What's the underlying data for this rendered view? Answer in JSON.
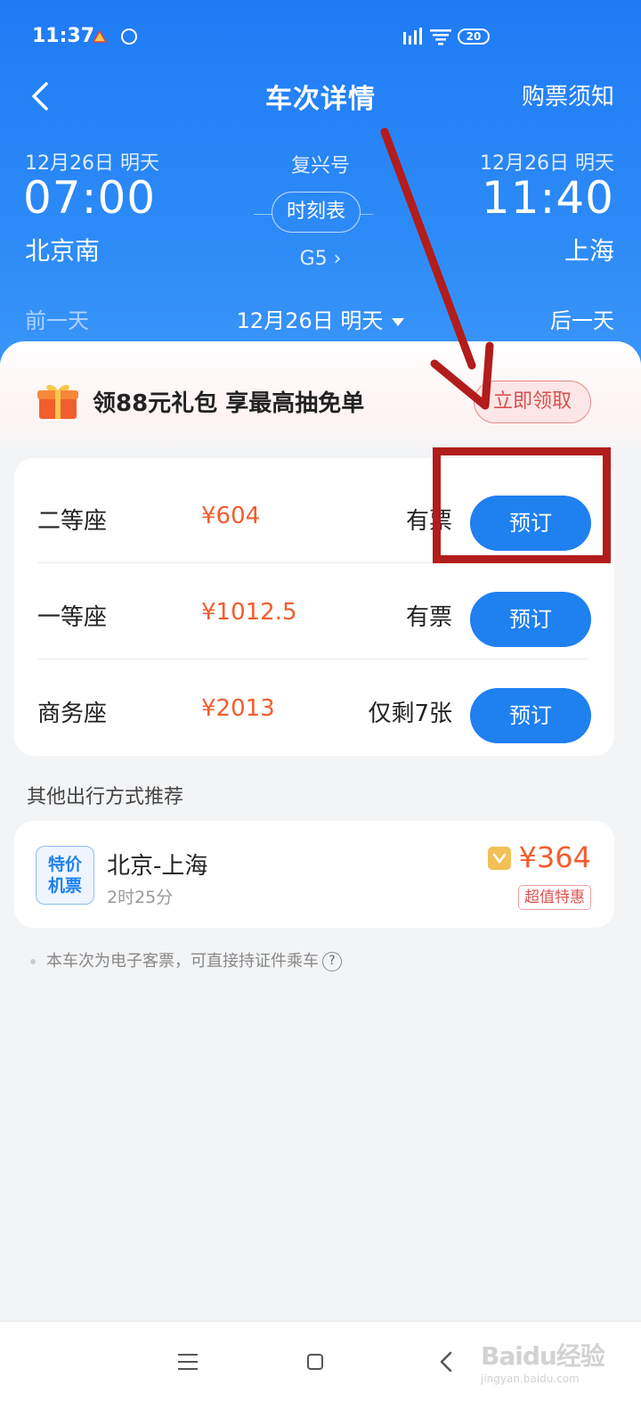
{
  "status_bar": {
    "time": "11:37",
    "battery": "20"
  },
  "nav": {
    "title": "车次详情",
    "notice_link": "购票须知"
  },
  "trip": {
    "departure": {
      "date": "12月26日 明天",
      "time": "07:00",
      "station": "北京南"
    },
    "arrival": {
      "date": "12月26日 明天",
      "time": "11:40",
      "station": "上海"
    },
    "train_type": "复兴号",
    "schedule_label": "时刻表",
    "train_no": "G5 ›"
  },
  "date_nav": {
    "prev": "前一天",
    "current": "12月26日 明天",
    "next": "后一天"
  },
  "promo": {
    "text": "领88元礼包 享最高抽免单",
    "button": "立即领取"
  },
  "seats": [
    {
      "name": "二等座",
      "price": "¥604",
      "availability": "有票",
      "button": "预订"
    },
    {
      "name": "一等座",
      "price": "¥1012.5",
      "availability": "有票",
      "button": "预订"
    },
    {
      "name": "商务座",
      "price": "¥2013",
      "availability": "仅剩7张",
      "button": "预订"
    }
  ],
  "other": {
    "title": "其他出行方式推荐",
    "flight": {
      "badge_line1": "特价",
      "badge_line2": "机票",
      "route": "北京-上海",
      "duration": "2时25分",
      "price": "¥364",
      "tag": "超值特惠"
    }
  },
  "footer_notice": "本车次为电子客票，可直接持证件乘车",
  "help_icon_glyph": "?",
  "watermark": {
    "main": "Baidu经验",
    "sub": "jingyan.baidu.com"
  },
  "colors": {
    "header_blue": "#1f7bf5",
    "button_blue": "#1f80f0",
    "price_orange": "#f25d2e",
    "annotation_red": "#b21c1c"
  },
  "icons": [
    "back-arrow-icon",
    "gift-icon",
    "ticket-icon",
    "help-icon",
    "menu-icon",
    "home-icon",
    "nav-back-icon",
    "signal-icon",
    "wifi-icon"
  ]
}
